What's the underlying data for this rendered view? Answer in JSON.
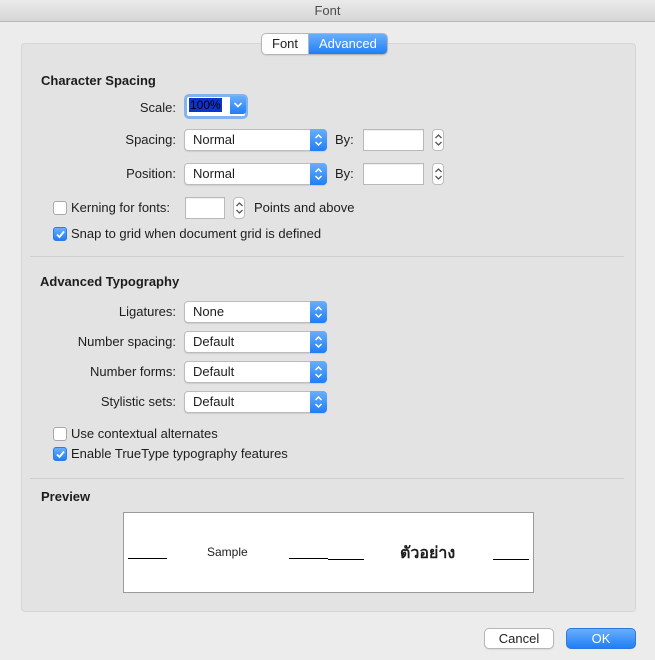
{
  "window": {
    "title": "Font"
  },
  "tabs": [
    {
      "label": "Font",
      "active": false
    },
    {
      "label": "Advanced",
      "active": true
    }
  ],
  "character_spacing": {
    "title": "Character Spacing",
    "scale": {
      "label": "Scale:",
      "value": "100%"
    },
    "spacing": {
      "label": "Spacing:",
      "value": "Normal",
      "by_label": "By:",
      "by_value": ""
    },
    "position": {
      "label": "Position:",
      "value": "Normal",
      "by_label": "By:",
      "by_value": ""
    },
    "kerning": {
      "label": "Kerning for fonts:",
      "checked": false,
      "value": "",
      "suffix": "Points and above"
    },
    "snap_to_grid": {
      "label": "Snap to grid when document grid is defined",
      "checked": true
    }
  },
  "advanced_typography": {
    "title": "Advanced Typography",
    "ligatures": {
      "label": "Ligatures:",
      "value": "None"
    },
    "number_spacing": {
      "label": "Number spacing:",
      "value": "Default"
    },
    "number_forms": {
      "label": "Number forms:",
      "value": "Default"
    },
    "stylistic_sets": {
      "label": "Stylistic sets:",
      "value": "Default"
    },
    "contextual_alternates": {
      "label": "Use contextual alternates",
      "checked": false
    },
    "truetype_features": {
      "label": "Enable TrueType typography features",
      "checked": true
    }
  },
  "preview": {
    "title": "Preview",
    "sample_latin": "Sample",
    "sample_thai": "ตัวอย่าง"
  },
  "buttons": {
    "cancel": "Cancel",
    "ok": "OK"
  },
  "colors": {
    "accent": "#1f7ff6",
    "selection": "#0d33cf"
  },
  "icons": {
    "popup_arrows": "up-down-chevron-icon",
    "checkmark": "checkmark-icon",
    "stepper": "stepper-arrows-icon"
  }
}
